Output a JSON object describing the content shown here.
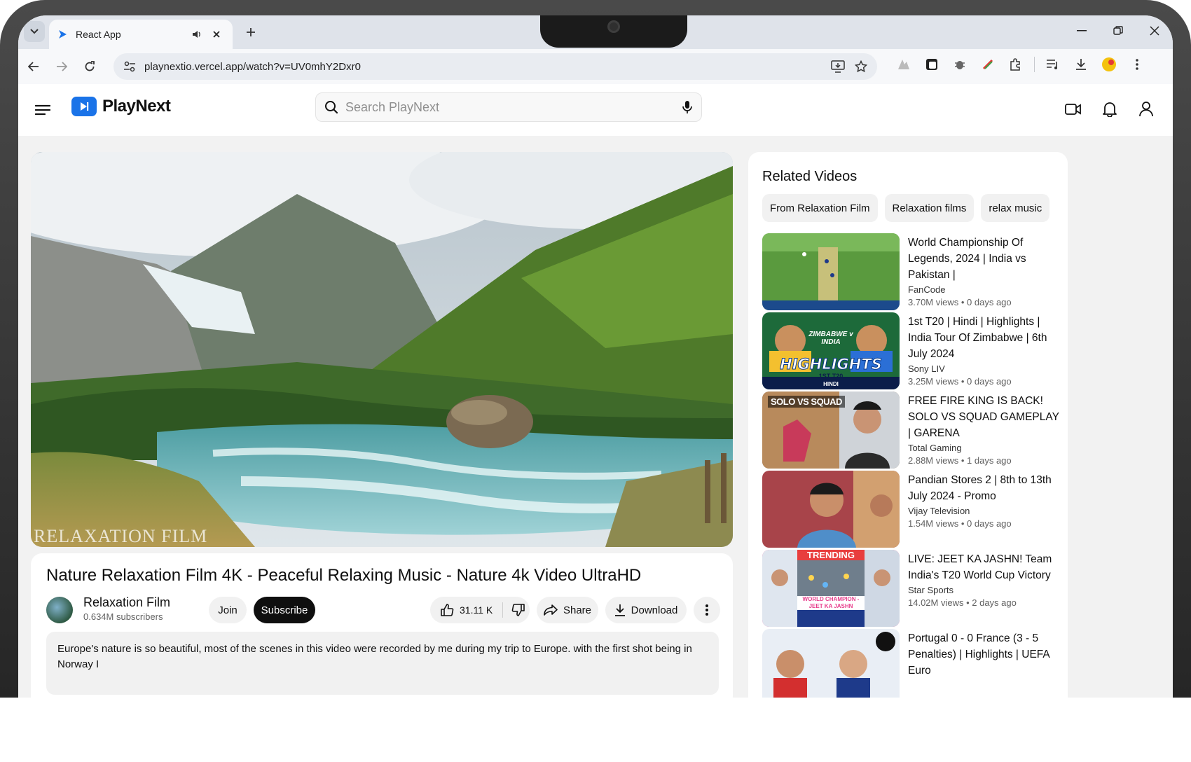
{
  "browser": {
    "tab_title": "React App",
    "url": "playnextio.vercel.app/watch?v=UV0mhY2Dxr0"
  },
  "app": {
    "brand": "PlayNext",
    "search_placeholder": "Search PlayNext"
  },
  "video": {
    "title": "Nature Relaxation Film 4K - Peaceful Relaxing Music - Nature 4k Video UltraHD",
    "watermark": "RELAXATION FILM",
    "channel": "Relaxation Film",
    "subscribers": "0.634M subscribers",
    "join_label": "Join",
    "subscribe_label": "Subscribe",
    "likes": "31.11 K",
    "share_label": "Share",
    "download_label": "Download",
    "description": "Europe's nature is so beautiful, most of the scenes in this video were recorded by me during my trip to Europe. with the first shot being in Norway I"
  },
  "related": {
    "heading": "Related Videos",
    "chips": [
      "From Relaxation Film",
      "Relaxation films",
      "relax music"
    ],
    "items": [
      {
        "title": "World Championship Of Legends, 2024 | India vs Pakistan |",
        "channel": "FanCode",
        "stats": "3.70M views • 0 days ago"
      },
      {
        "title": "1st T20 | Hindi | Highlights | India Tour Of Zimbabwe | 6th July 2024",
        "channel": "Sony LIV",
        "stats": "3.25M views • 0 days ago",
        "thumb_text": "HIGHLIGHTS",
        "thumb_sub": "1ST T20",
        "thumb_lang": "HINDI",
        "thumb_top": "ZIMBABWE v INDIA"
      },
      {
        "title": "FREE FIRE KING IS BACK! SOLO VS SQUAD GAMEPLAY | GARENA",
        "channel": "Total Gaming",
        "stats": "2.88M views • 1 days ago",
        "thumb_text": "SOLO VS SQUAD"
      },
      {
        "title": "Pandian Stores 2 | 8th to 13th July 2024 - Promo",
        "channel": "Vijay Television",
        "stats": "1.54M views • 0 days ago"
      },
      {
        "title": "LIVE: JEET KA JASHN! Team India's T20 World Cup Victory",
        "channel": "Star Sports",
        "stats": "14.02M views • 2 days ago",
        "thumb_text": "TRENDING",
        "thumb_sub": "WORLD CHAMPION - JEET KA JASHN"
      },
      {
        "title": "Portugal 0 - 0 France (3 - 5 Penalties) | Highlights | UEFA Euro",
        "channel": "",
        "stats": ""
      }
    ]
  },
  "colors": {
    "accent": "#1a73e8",
    "subscribe_bg": "#0f0f0f"
  }
}
